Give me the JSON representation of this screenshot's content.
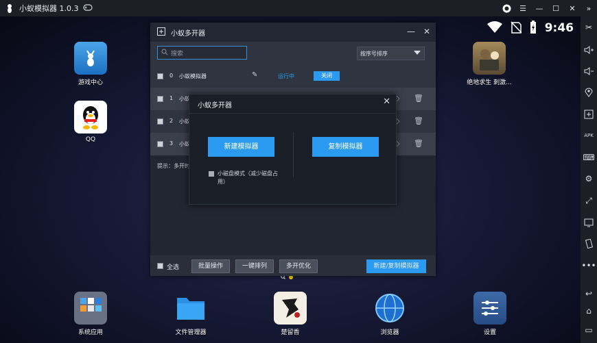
{
  "app": {
    "title": "小蚁模拟器 1.0.3"
  },
  "status": {
    "time": "9:46"
  },
  "desktop": {
    "apps": [
      {
        "label": "游戏中心"
      },
      {
        "label": "QQ"
      },
      {
        "label": "绝地求生 刺激..."
      },
      {
        "label": "系统应用"
      },
      {
        "label": "文件管理器"
      },
      {
        "label": "楚留香"
      },
      {
        "label": "浏览器"
      },
      {
        "label": "设置"
      }
    ]
  },
  "multi": {
    "title": "小蚁多开器",
    "search_placeholder": "搜索",
    "sort_label": "按序号排序",
    "rows": [
      {
        "index": "0",
        "name": "小蚁模拟器",
        "status": "运行中",
        "action": "关闭"
      },
      {
        "index": "1",
        "name": "小蚁"
      },
      {
        "index": "2",
        "name": "小蚁"
      },
      {
        "index": "3",
        "name": "小蚁"
      }
    ],
    "tip": "提示：多开时",
    "footer": {
      "select_all": "全选",
      "batch": "批量操作",
      "arrange": "一键排列",
      "optimize": "多开优化",
      "new_copy": "新建/复制模拟器"
    }
  },
  "modal": {
    "title": "小蚁多开器",
    "new_btn": "新建模拟器",
    "copy_btn": "复制模拟器",
    "small_disk": "小磁盘模式（减少磁盘占用）"
  },
  "colors": {
    "accent": "#2b9af1",
    "titlebar": "#1c1f26"
  }
}
